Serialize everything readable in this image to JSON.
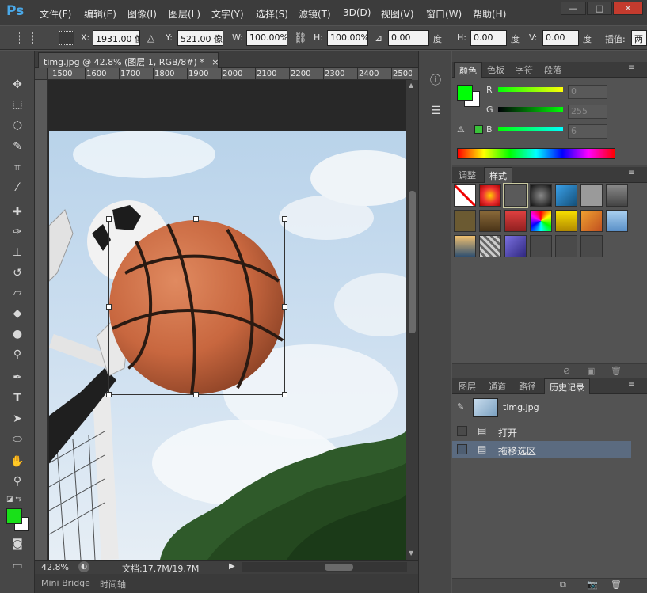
{
  "app": {
    "logo": "Ps"
  },
  "menu": [
    {
      "label": "文件(F)"
    },
    {
      "label": "编辑(E)"
    },
    {
      "label": "图像(I)"
    },
    {
      "label": "图层(L)"
    },
    {
      "label": "文字(Y)"
    },
    {
      "label": "选择(S)"
    },
    {
      "label": "滤镜(T)"
    },
    {
      "label": "3D(D)"
    },
    {
      "label": "视图(V)"
    },
    {
      "label": "窗口(W)"
    },
    {
      "label": "帮助(H)"
    }
  ],
  "window_controls": {
    "minimize": "—",
    "maximize": "□",
    "close": "✕"
  },
  "options": {
    "x_label": "X:",
    "x_value": "1931.00 像",
    "y_label": "Y:",
    "y_value": "521.00 像",
    "w_label": "W:",
    "w_value": "100.00%",
    "h_label": "H:",
    "h_value": "100.00%",
    "angle_value": "0.00",
    "angle_unit": "度",
    "hskew_label": "H:",
    "hskew_value": "0.00",
    "hskew_unit": "度",
    "vskew_label": "V:",
    "vskew_value": "0.00",
    "vskew_unit": "度",
    "interp_label": "插值:",
    "interp_value": "两"
  },
  "document": {
    "tab_title": "timg.jpg @ 42.8% (图层 1, RGB/8#) *",
    "tab_close": "×",
    "ruler_ticks": [
      "1500",
      "1600",
      "1700",
      "1800",
      "1900",
      "2000",
      "2100",
      "2200",
      "2300",
      "2400",
      "2500"
    ],
    "zoom": "42.8%",
    "doc_info": "文档:17.7M/19.7M"
  },
  "bottom_tabs": {
    "mini_bridge": "Mini Bridge",
    "timeline": "时间轴"
  },
  "color_panel": {
    "tabs": [
      "颜色",
      "色板",
      "字符",
      "段落"
    ],
    "active_tab": "颜色",
    "r_label": "R",
    "r_value": "0",
    "g_label": "G",
    "g_value": "255",
    "b_label": "B",
    "b_value": "6",
    "foreground_color": "#00ff06",
    "background_color": "#ffffff"
  },
  "styles_panel": {
    "tabs": [
      "调整",
      "样式"
    ],
    "active_tab": "样式",
    "swatch_count": 24
  },
  "history_panel": {
    "tabs": [
      "图层",
      "通道",
      "路径",
      "历史记录"
    ],
    "active_tab": "历史记录",
    "snapshot_name": "timg.jpg",
    "items": [
      {
        "label": "打开"
      },
      {
        "label": "拖移选区"
      }
    ]
  },
  "toolbox": {
    "foreground_color": "#19e019",
    "background_color": "#ffffff"
  }
}
